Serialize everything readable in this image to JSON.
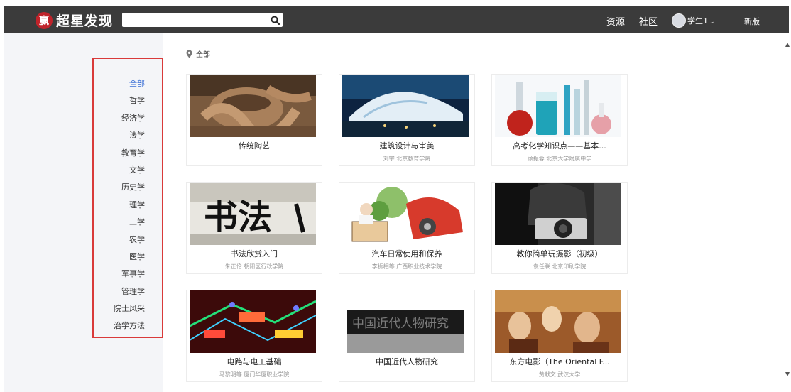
{
  "header": {
    "logo_char": "赢",
    "logo_text": "超星发现",
    "search_placeholder": "",
    "nav": [
      "资源",
      "社区"
    ],
    "user_name": "学生1",
    "new_version": "新版"
  },
  "categories": {
    "items": [
      "全部",
      "哲学",
      "经济学",
      "法学",
      "教育学",
      "文学",
      "历史学",
      "理学",
      "工学",
      "农学",
      "医学",
      "军事学",
      "管理学",
      "院士风采",
      "治学方法"
    ],
    "active_index": 0
  },
  "breadcrumb": {
    "label": "全部"
  },
  "courses": [
    {
      "title": "传统陶艺",
      "sub": ""
    },
    {
      "title": "建筑设计与审美",
      "sub": "刘宇 北京教育学院"
    },
    {
      "title": "高考化学知识点——基本...",
      "sub": "顾振蓉 北京大学附属中学"
    },
    {
      "title": "书法欣赏入门",
      "sub": "朱正伦 朝阳区行政学院"
    },
    {
      "title": "汽车日常使用和保养",
      "sub": "李振相等 广西职业技术学院"
    },
    {
      "title": "教你简单玩摄影（初级）",
      "sub": "袁任联 北京印刷学院"
    },
    {
      "title": "电路与电工基础",
      "sub": "马黎明等 厦门华厦职业学院"
    },
    {
      "title": "中国近代人物研究",
      "sub": ""
    },
    {
      "title": "东方电影（The Oriental F...",
      "sub": "黄献文 武汉大学"
    }
  ],
  "thumb_texts": {
    "calligraphy": "书法",
    "history": "中国近代人物研究"
  }
}
